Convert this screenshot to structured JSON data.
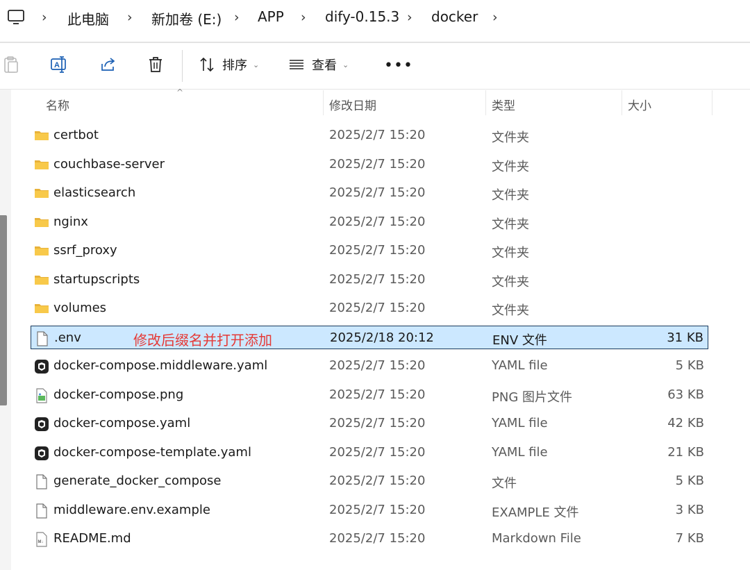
{
  "breadcrumb": {
    "items": [
      "此电脑",
      "新加卷 (E:)",
      "APP",
      "dify-0.15.3",
      "docker"
    ]
  },
  "toolbar": {
    "sort_label": "排序",
    "view_label": "查看",
    "more_label": "•••"
  },
  "columns": {
    "name": "名称",
    "date": "修改日期",
    "type": "类型",
    "size": "大小"
  },
  "annotation": "修改后缀名并打开添加",
  "files": [
    {
      "name": "certbot",
      "date": "2025/2/7 15:20",
      "type": "文件夹",
      "size": "",
      "icon": "folder-icon"
    },
    {
      "name": "couchbase-server",
      "date": "2025/2/7 15:20",
      "type": "文件夹",
      "size": "",
      "icon": "folder-icon"
    },
    {
      "name": "elasticsearch",
      "date": "2025/2/7 15:20",
      "type": "文件夹",
      "size": "",
      "icon": "folder-icon"
    },
    {
      "name": "nginx",
      "date": "2025/2/7 15:20",
      "type": "文件夹",
      "size": "",
      "icon": "folder-icon"
    },
    {
      "name": "ssrf_proxy",
      "date": "2025/2/7 15:20",
      "type": "文件夹",
      "size": "",
      "icon": "folder-icon"
    },
    {
      "name": "startupscripts",
      "date": "2025/2/7 15:20",
      "type": "文件夹",
      "size": "",
      "icon": "folder-icon"
    },
    {
      "name": "volumes",
      "date": "2025/2/7 15:20",
      "type": "文件夹",
      "size": "",
      "icon": "folder-icon"
    },
    {
      "name": ".env",
      "date": "2025/2/18 20:12",
      "type": "ENV 文件",
      "size": "31 KB",
      "icon": "file-icon",
      "selected": true
    },
    {
      "name": "docker-compose.middleware.yaml",
      "date": "2025/2/7 15:20",
      "type": "YAML file",
      "size": "5 KB",
      "icon": "yaml-icon"
    },
    {
      "name": "docker-compose.png",
      "date": "2025/2/7 15:20",
      "type": "PNG 图片文件",
      "size": "63 KB",
      "icon": "image-file-icon"
    },
    {
      "name": "docker-compose.yaml",
      "date": "2025/2/7 15:20",
      "type": "YAML file",
      "size": "42 KB",
      "icon": "yaml-icon"
    },
    {
      "name": "docker-compose-template.yaml",
      "date": "2025/2/7 15:20",
      "type": "YAML file",
      "size": "21 KB",
      "icon": "yaml-icon"
    },
    {
      "name": "generate_docker_compose",
      "date": "2025/2/7 15:20",
      "type": "文件",
      "size": "5 KB",
      "icon": "file-icon"
    },
    {
      "name": "middleware.env.example",
      "date": "2025/2/7 15:20",
      "type": "EXAMPLE 文件",
      "size": "3 KB",
      "icon": "file-icon"
    },
    {
      "name": "README.md",
      "date": "2025/2/7 15:20",
      "type": "Markdown File",
      "size": "7 KB",
      "icon": "markdown-file-icon"
    }
  ],
  "colors": {
    "selection_bg": "#cce8ff",
    "selection_border": "#1a3a5c",
    "annotation": "#e53935",
    "folder": "#f8c94a"
  }
}
